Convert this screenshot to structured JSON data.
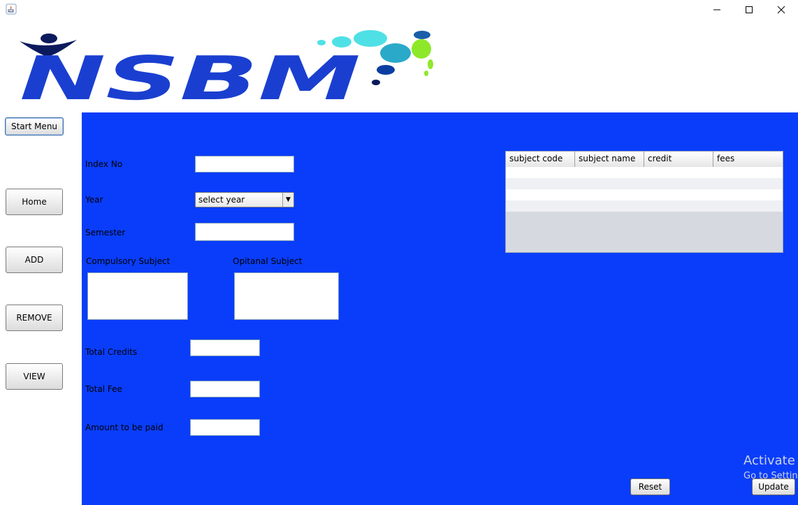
{
  "window": {
    "minimize_glyph": "—",
    "maximize_glyph": "☐",
    "close_glyph": "✕"
  },
  "logo": {
    "text": "NSBM",
    "colors": {
      "primary": "#1a3fd0",
      "navy": "#0b1a5c",
      "cyan": "#4fe0e6",
      "teal": "#2aa9c9",
      "green": "#8ee82a"
    }
  },
  "nav": {
    "start_menu": "Start Menu",
    "home": "Home",
    "add": "ADD",
    "remove": "REMOVE",
    "view": "VIEW"
  },
  "form": {
    "index_no_label": "Index No",
    "year_label": "Year",
    "year_selected": "select year",
    "semester_label": "Semester",
    "compulsory_label": "Compulsory Subject",
    "optional_label": "Opitanal Subject",
    "total_credits_label": "Total Credits",
    "total_fee_label": "Total Fee",
    "amount_label": "Amount to be paid"
  },
  "table": {
    "columns": [
      "subject code",
      "subject name",
      "credit",
      "fees"
    ],
    "rows": []
  },
  "actions": {
    "reset": "Reset",
    "update": "Update"
  },
  "watermark": {
    "line1": "Activate W",
    "line2": "Go to Settin"
  },
  "colors": {
    "panel_bg": "#0a3dfa",
    "window_bg": "#ffffff"
  }
}
